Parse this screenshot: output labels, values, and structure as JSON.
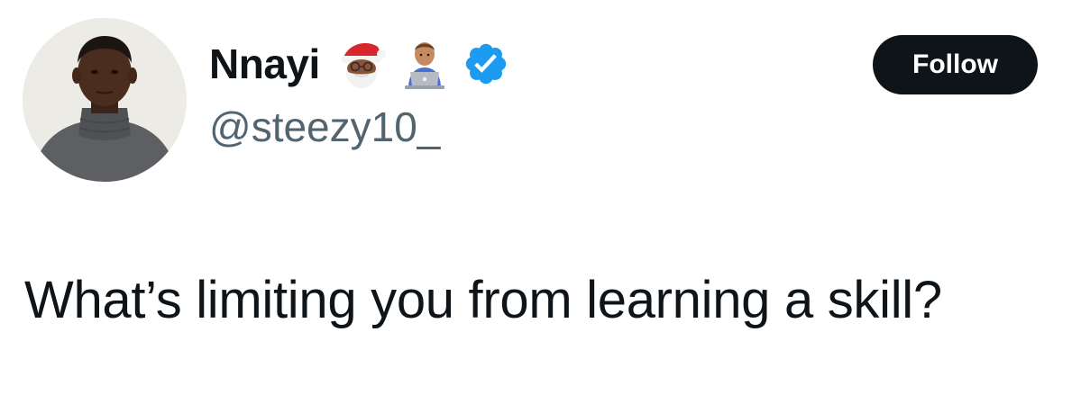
{
  "author": {
    "display_name": "Nnayi",
    "handle": "@steezy10_",
    "badges": [
      "santa-emoji",
      "technologist-emoji",
      "verified-badge-icon"
    ]
  },
  "follow_button": {
    "label": "Follow"
  },
  "tweet": {
    "text": "What’s limiting you from learning a skill?"
  },
  "colors": {
    "text_primary": "#0f1419",
    "text_secondary": "#536471",
    "verified_blue": "#1d9bf0",
    "button_bg": "#0f1419",
    "button_text": "#ffffff"
  }
}
